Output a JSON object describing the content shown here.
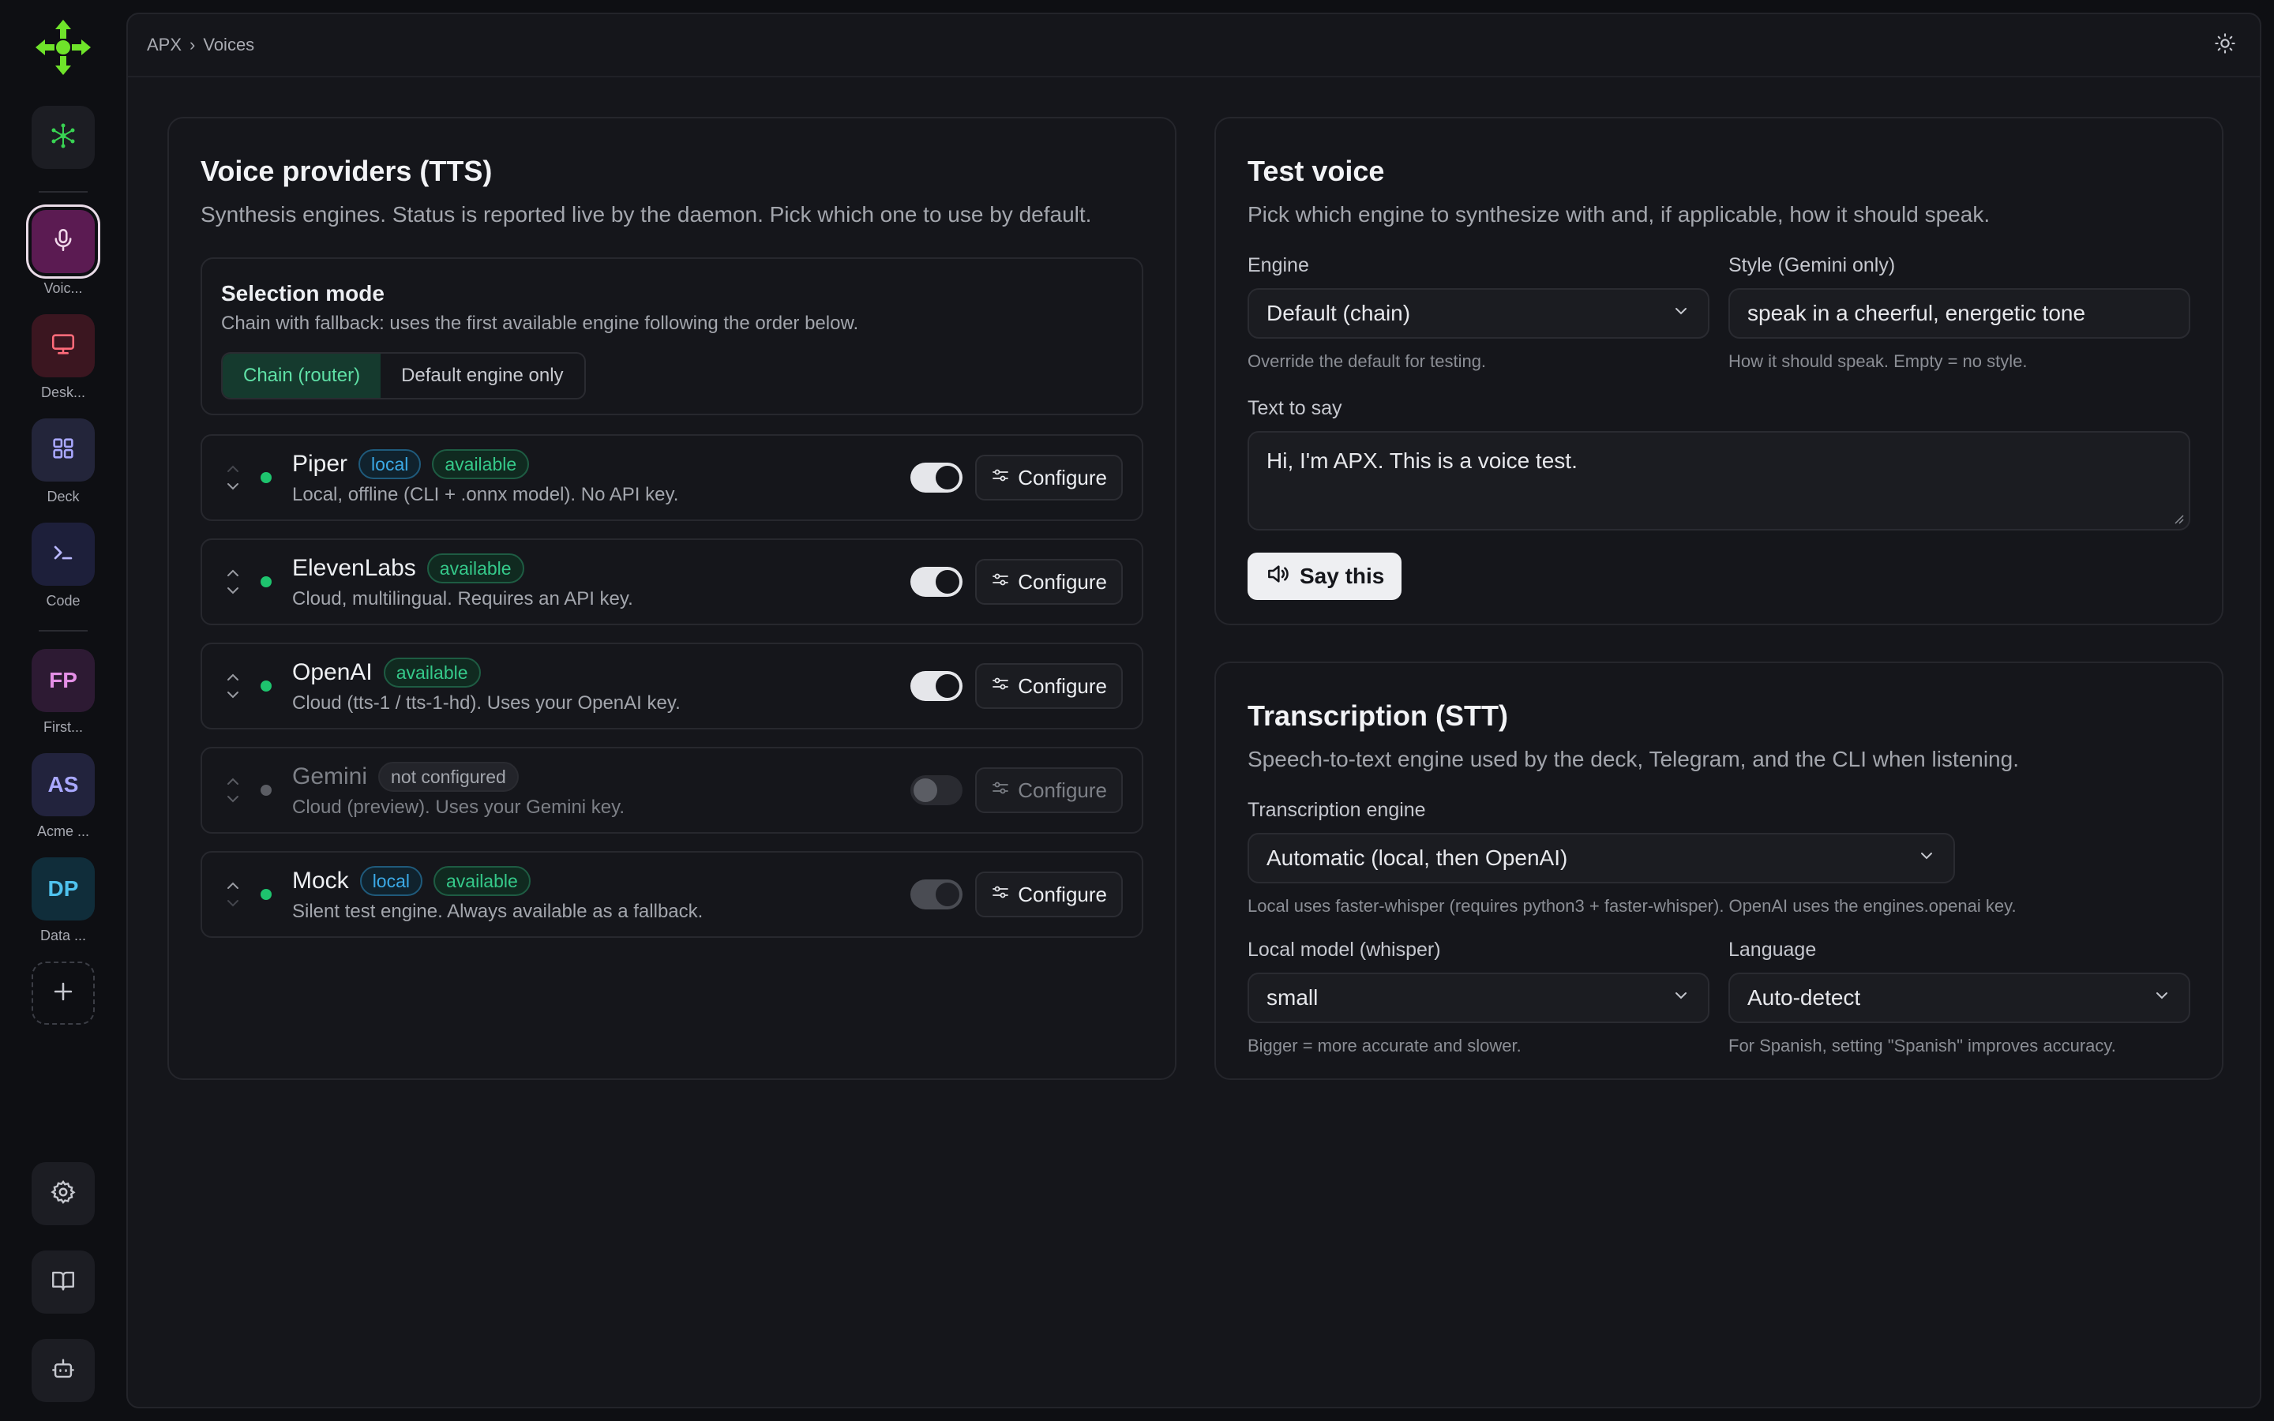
{
  "breadcrumb": {
    "root": "APX",
    "sep": "›",
    "current": "Voices"
  },
  "rail": {
    "apps": [
      {
        "label": "Voic...",
        "icon": "mic-icon"
      },
      {
        "label": "Desk...",
        "icon": "monitor-icon"
      },
      {
        "label": "Deck",
        "icon": "grid-icon"
      },
      {
        "label": "Code",
        "icon": "terminal-icon"
      },
      {
        "label": "First...",
        "initials": "FP"
      },
      {
        "label": "Acme ...",
        "initials": "AS"
      },
      {
        "label": "Data ...",
        "initials": "DP"
      }
    ]
  },
  "tts": {
    "title": "Voice providers (TTS)",
    "subtitle": "Synthesis engines. Status is reported live by the daemon. Pick which one to use by default.",
    "mode_title": "Selection mode",
    "mode_desc": "Chain with fallback: uses the first available engine following the order below.",
    "mode_options": [
      "Chain (router)",
      "Default engine only"
    ],
    "configure_label": "Configure",
    "providers": [
      {
        "name": "Piper",
        "badges": [
          "local",
          "available"
        ],
        "desc": "Local, offline (CLI + .onnx model). No API key."
      },
      {
        "name": "ElevenLabs",
        "badges": [
          "available"
        ],
        "desc": "Cloud, multilingual. Requires an API key."
      },
      {
        "name": "OpenAI",
        "badges": [
          "available"
        ],
        "desc": "Cloud (tts-1 / tts-1-hd). Uses your OpenAI key."
      },
      {
        "name": "Gemini",
        "badges": [
          "not configured"
        ],
        "desc": "Cloud (preview). Uses your Gemini key."
      },
      {
        "name": "Mock",
        "badges": [
          "local",
          "available"
        ],
        "desc": "Silent test engine. Always available as a fallback."
      }
    ]
  },
  "test": {
    "title": "Test voice",
    "subtitle": "Pick which engine to synthesize with and, if applicable, how it should speak.",
    "engine_label": "Engine",
    "engine_value": "Default (chain)",
    "engine_hint": "Override the default for testing.",
    "style_label": "Style (Gemini only)",
    "style_value": "speak in a cheerful, energetic tone",
    "style_hint": "How it should speak. Empty = no style.",
    "text_label": "Text to say",
    "text_value": "Hi, I'm APX. This is a voice test.",
    "say_label": "Say this"
  },
  "stt": {
    "title": "Transcription (STT)",
    "subtitle": "Speech-to-text engine used by the deck, Telegram, and the CLI when listening.",
    "engine_label": "Transcription engine",
    "engine_value": "Automatic (local, then OpenAI)",
    "engine_hint": "Local uses faster-whisper (requires python3 + faster-whisper). OpenAI uses the engines.openai key.",
    "model_label": "Local model (whisper)",
    "model_value": "small",
    "model_hint": "Bigger = more accurate and slower.",
    "lang_label": "Language",
    "lang_value": "Auto-detect",
    "lang_hint": "For Spanish, setting \"Spanish\" improves accuracy."
  },
  "colors": {
    "accent_green": "#1ec46e",
    "brand_green": "#6fe32a",
    "active_app": "#5b1b52"
  }
}
